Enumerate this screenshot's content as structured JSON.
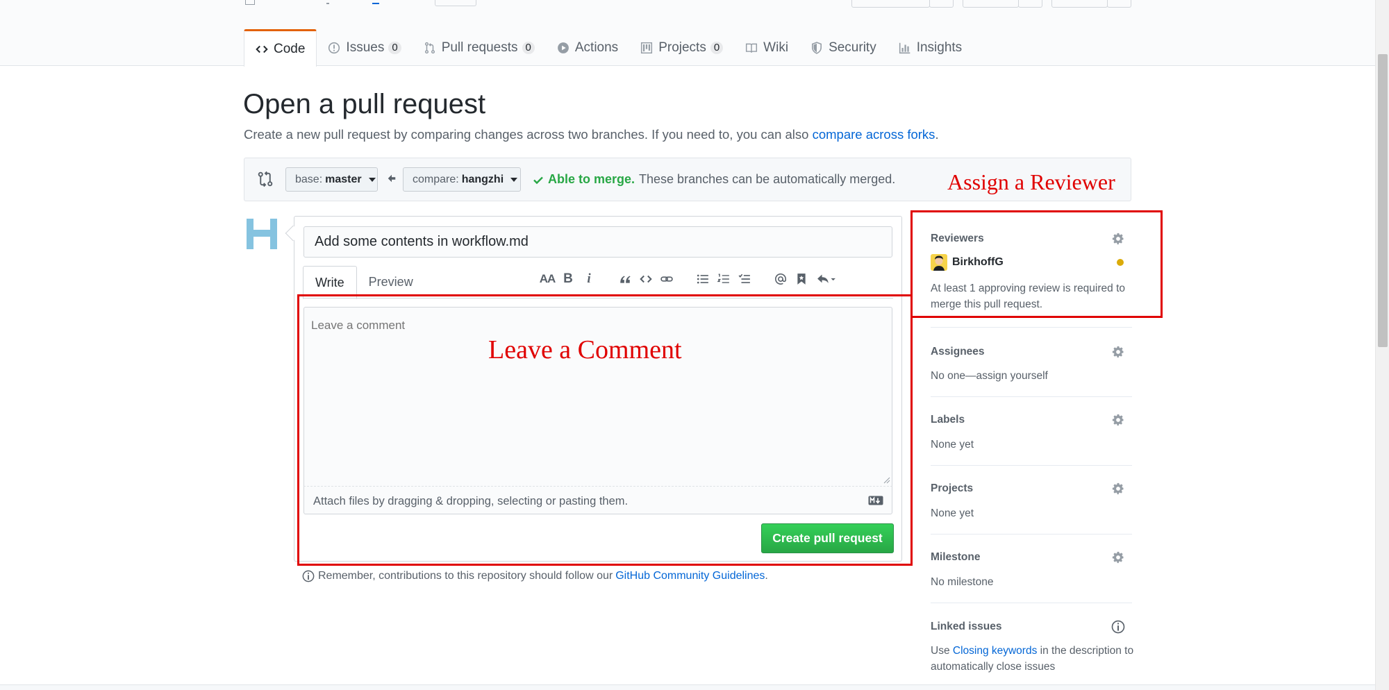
{
  "repo_tabs": [
    {
      "label": "Code",
      "counter": "",
      "icon": "code-icon"
    },
    {
      "label": "Issues",
      "counter": "0",
      "icon": "issue-opened-icon"
    },
    {
      "label": "Pull requests",
      "counter": "0",
      "icon": "git-pull-request-icon"
    },
    {
      "label": "Actions",
      "counter": "",
      "icon": "play-icon"
    },
    {
      "label": "Projects",
      "counter": "0",
      "icon": "project-icon"
    },
    {
      "label": "Wiki",
      "counter": "",
      "icon": "book-icon"
    },
    {
      "label": "Security",
      "counter": "",
      "icon": "shield-icon"
    },
    {
      "label": "Insights",
      "counter": "",
      "icon": "graph-icon"
    }
  ],
  "page": {
    "title": "Open a pull request",
    "subtitle": "Create a new pull request by comparing changes across two branches. If you need to, you can also ",
    "subtitle_link": "compare across forks",
    "subtitle_end": "."
  },
  "branches": {
    "base_prefix": "base:",
    "base_value": "master",
    "compare_prefix": "compare:",
    "compare_value": "hangzhi",
    "merge_ok": "Able to merge.",
    "merge_text": "These branches can be automatically merged."
  },
  "editor": {
    "title_value": "Add some contents in workflow.md",
    "tab_write": "Write",
    "tab_preview": "Preview",
    "toolbar": {
      "heading": "AA",
      "bold": "B",
      "italic": "i"
    },
    "comment_placeholder": "Leave a comment",
    "attach_text": "Attach files by dragging & dropping, selecting or pasting them.",
    "submit_label": "Create pull request"
  },
  "guidelines": {
    "text": "Remember, contributions to this repository should follow our",
    "link": "GitHub Community Guidelines",
    "end": "."
  },
  "sidebar": {
    "reviewers": {
      "heading": "Reviewers",
      "name": "BirkhoffG",
      "note": "At least 1 approving review is required to merge this pull request."
    },
    "assignees": {
      "heading": "Assignees",
      "value": "No one—assign yourself"
    },
    "labels": {
      "heading": "Labels",
      "value": "None yet"
    },
    "projects": {
      "heading": "Projects",
      "value": "None yet"
    },
    "milestone": {
      "heading": "Milestone",
      "value": "No milestone"
    },
    "linked_issues": {
      "heading": "Linked issues",
      "pre": "Use ",
      "link": "Closing keywords",
      "post": " in the description to automatically close issues"
    }
  },
  "annotations": {
    "comment_label": "Leave a Comment",
    "reviewer_label": "Assign a Reviewer"
  },
  "colors": {
    "accent_orange": "#e36209",
    "link_blue": "#0366d6",
    "success_green": "#28a745",
    "annotation_red": "#e00000",
    "pending_yellow": "#dbab09"
  }
}
